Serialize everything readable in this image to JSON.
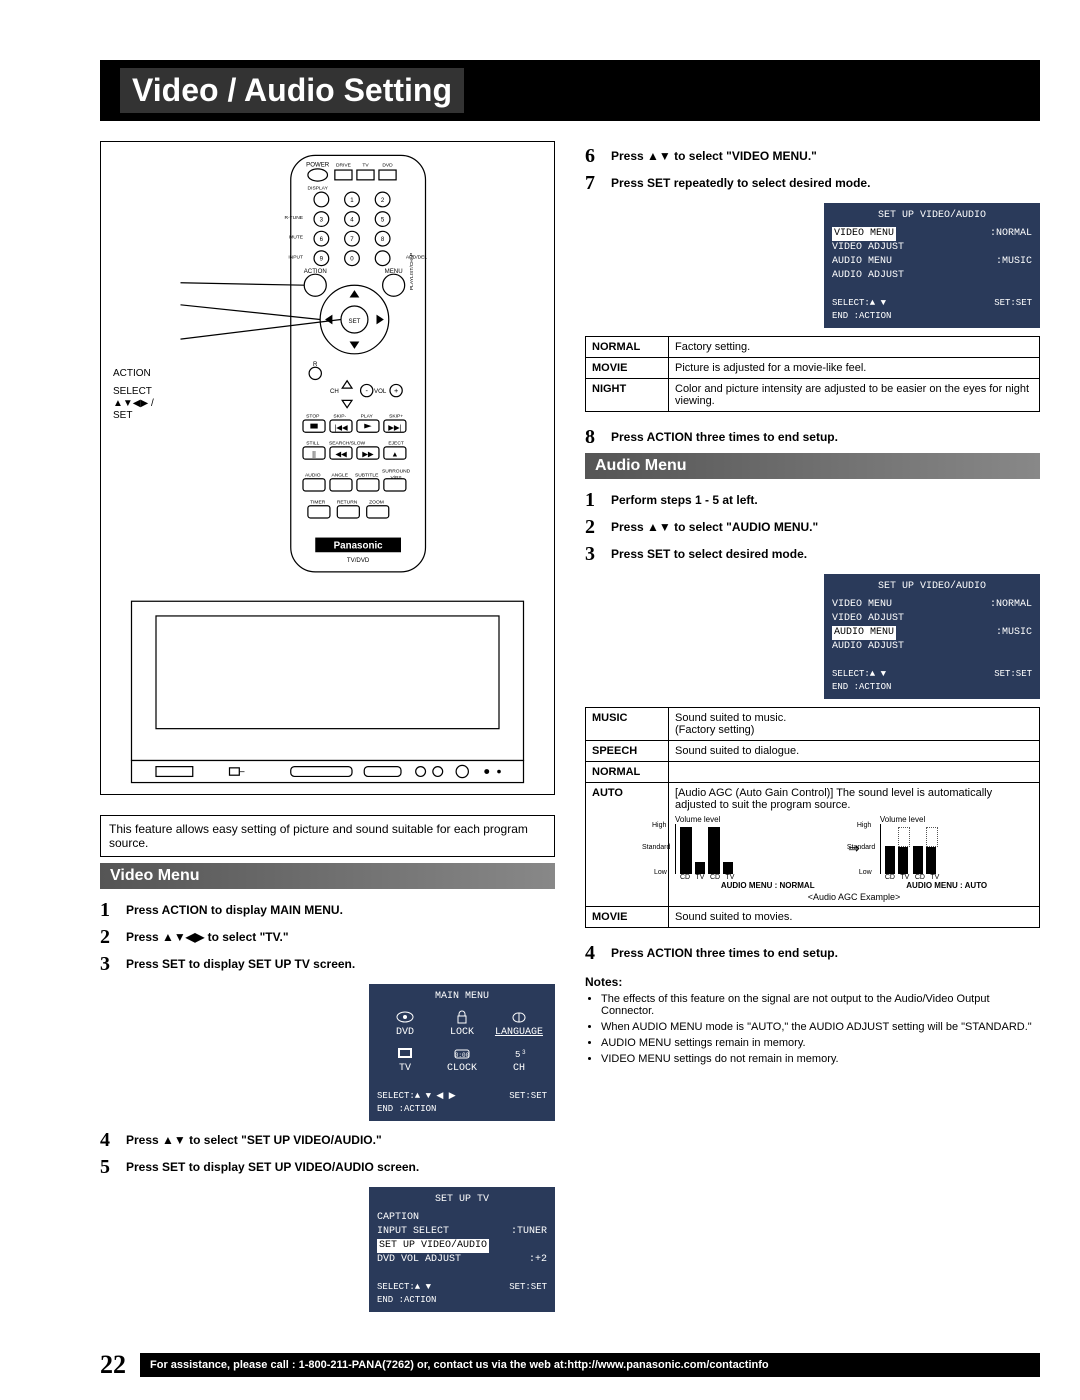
{
  "page_title": "Video / Audio Setting",
  "page_number": "22",
  "assistance": "For assistance, please call : 1-800-211-PANA(7262) or, contact us via the web at:http://www.panasonic.com/contactinfo",
  "remote_labels": {
    "action": "ACTION",
    "select": "SELECT",
    "arrows": "▲▼◀▶ /",
    "set": "SET",
    "brand": "Panasonic",
    "model": "TV/DVD"
  },
  "feature_note": "This feature allows easy setting of picture and sound suitable for each program source.",
  "video_menu": {
    "heading": "Video Menu",
    "steps_a": [
      {
        "n": "1",
        "t": "Press ACTION to display MAIN MENU."
      },
      {
        "n": "2",
        "t": "Press ▲▼◀▶ to select \"TV.\""
      },
      {
        "n": "3",
        "t": "Press SET to display SET UP TV screen."
      }
    ],
    "steps_b": [
      {
        "n": "4",
        "t": "Press ▲▼ to select \"SET UP VIDEO/AUDIO.\""
      },
      {
        "n": "5",
        "t": "Press SET to display SET UP VIDEO/AUDIO screen."
      }
    ]
  },
  "main_menu_osd": {
    "title": "MAIN MENU",
    "items": [
      "DVD",
      "LOCK",
      "LANGUAGE",
      "TV",
      "CLOCK",
      "CH"
    ],
    "footer_l": "SELECT:▲ ▼ ◀ ▶",
    "footer_r": "SET:SET",
    "footer_end": "END    :ACTION"
  },
  "setup_tv_osd": {
    "title": "SET UP TV",
    "rows": [
      {
        "l": "CAPTION",
        "r": ""
      },
      {
        "l": "INPUT SELECT",
        "r": ":TUNER"
      },
      {
        "l_hl": "SET UP VIDEO/AUDIO",
        "r": ""
      },
      {
        "l": "DVD VOL ADJUST",
        "r": ":+2"
      }
    ],
    "footer_l": "SELECT:▲ ▼",
    "footer_r": "SET:SET",
    "footer_end": "END    :ACTION"
  },
  "right_top_steps": [
    {
      "n": "6",
      "t": "Press ▲▼ to select \"VIDEO MENU.\""
    },
    {
      "n": "7",
      "t": "Press SET repeatedly to select desired mode."
    }
  ],
  "va_osd1": {
    "title": "SET UP VIDEO/AUDIO",
    "rows": [
      {
        "l_hl": "VIDEO MENU",
        "r": ":NORMAL"
      },
      {
        "l": "VIDEO ADJUST",
        "r": ""
      },
      {
        "l": "AUDIO MENU",
        "r": ":MUSIC"
      },
      {
        "l": "AUDIO ADJUST",
        "r": ""
      }
    ],
    "footer_l": "SELECT:▲ ▼",
    "footer_r": "SET:SET",
    "footer_end": "END    :ACTION"
  },
  "video_modes": [
    {
      "name": "NORMAL",
      "desc": "Factory setting."
    },
    {
      "name": "MOVIE",
      "desc": "Picture is adjusted for a movie-like feel."
    },
    {
      "name": "NIGHT",
      "desc": "Color and picture intensity are adjusted to be easier on the eyes for night viewing."
    }
  ],
  "step8": {
    "n": "8",
    "t": "Press ACTION three times to end setup."
  },
  "audio_menu": {
    "heading": "Audio Menu",
    "steps": [
      {
        "n": "1",
        "t": "Perform steps 1 - 5 at left."
      },
      {
        "n": "2",
        "t": "Press ▲▼ to select \"AUDIO MENU.\""
      },
      {
        "n": "3",
        "t": "Press SET to select desired mode."
      }
    ]
  },
  "va_osd2": {
    "title": "SET UP VIDEO/AUDIO",
    "rows": [
      {
        "l": "VIDEO MENU",
        "r": ":NORMAL"
      },
      {
        "l": "VIDEO ADJUST",
        "r": ""
      },
      {
        "l_hl": "AUDIO MENU",
        "r": ":MUSIC"
      },
      {
        "l": "AUDIO ADJUST",
        "r": ""
      }
    ],
    "footer_l": "SELECT:▲ ▼",
    "footer_r": "SET:SET",
    "footer_end": "END    :ACTION"
  },
  "audio_modes": [
    {
      "name": "MUSIC",
      "desc": "Sound suited to music.\n(Factory setting)"
    },
    {
      "name": "SPEECH",
      "desc": "Sound suited to dialogue."
    },
    {
      "name": "NORMAL",
      "desc": ""
    },
    {
      "name": "AUTO",
      "desc": "[Audio AGC (Auto Gain Control)] The sound level is automatically adjusted to suit the program source.",
      "diagram": true,
      "diag_labels": {
        "vl": "Volume level",
        "high": "High",
        "std": "Standard",
        "low": "Low",
        "cd": "CD",
        "tv": "TV",
        "left": "AUDIO MENU : NORMAL",
        "right": "AUDIO MENU : AUTO",
        "caption": "<Audio AGC Example>"
      }
    },
    {
      "name": "MOVIE",
      "desc": "Sound suited to movies."
    }
  ],
  "step4_audio": {
    "n": "4",
    "t": "Press ACTION three times to end setup."
  },
  "notes_hdr": "Notes:",
  "notes": [
    "The effects of this feature on the signal are not output to the Audio/Video Output Connector.",
    "When AUDIO MENU mode is \"AUTO,\" the AUDIO ADJUST setting will be \"STANDARD.\"",
    "AUDIO MENU settings remain in memory.",
    "VIDEO MENU settings do not remain in memory."
  ]
}
